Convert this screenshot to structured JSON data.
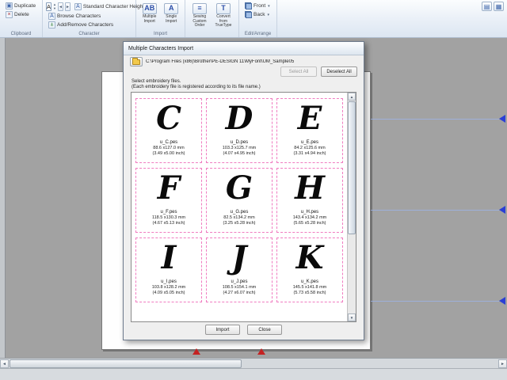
{
  "ribbon": {
    "clipboard": {
      "label": "Clipboard",
      "duplicate": "Duplicate",
      "delete": "Delete"
    },
    "character": {
      "label": "Character",
      "font_letter": "A",
      "standard_height": "Standard Character Height",
      "browse": "Browse Characters",
      "add_remove": "Add/Remove Characters"
    },
    "import": {
      "label": "Import",
      "multiple": "Multiple Import",
      "single": "Single Import"
    },
    "tools": {
      "sewing": "Sewing Custom Order",
      "convert": "Convert from TrueType"
    },
    "arrange": {
      "label": "Edit/Arrange",
      "front": "Front",
      "back": "Back"
    }
  },
  "dialog": {
    "title": "Multiple Characters Import",
    "path": "C:\\Program Files (x86)\\Brother\\PE-DESIGN 11\\MyFont\\UM_Sample05",
    "select_all": "Select All",
    "deselect_all": "Deselect All",
    "instruction_line1": "Select embroidery files.",
    "instruction_line2": "(Each embroidery file is registered according to its file name.)",
    "tiles": [
      {
        "letter": "C",
        "file": "u_C.pes",
        "size_mm": "88.6 x127.0 mm",
        "size_inch": "(3.49 x5.00 inch)"
      },
      {
        "letter": "D",
        "file": "u_D.pes",
        "size_mm": "103.3 x125.7 mm",
        "size_inch": "(4.07 x4.95 inch)"
      },
      {
        "letter": "E",
        "file": "u_E.pes",
        "size_mm": "84.2 x125.6 mm",
        "size_inch": "(3.31 x4.94 inch)"
      },
      {
        "letter": "F",
        "file": "u_F.pes",
        "size_mm": "118.5 x130.3 mm",
        "size_inch": "(4.67 x5.13 inch)"
      },
      {
        "letter": "G",
        "file": "u_G.pes",
        "size_mm": "82.5 x134.2 mm",
        "size_inch": "(3.25 x5.28 inch)"
      },
      {
        "letter": "H",
        "file": "u_H.pes",
        "size_mm": "143.4 x134.2 mm",
        "size_inch": "(5.65 x5.28 inch)"
      },
      {
        "letter": "I",
        "file": "u_I.pes",
        "size_mm": "103.8 x128.2 mm",
        "size_inch": "(4.09 x5.05 inch)"
      },
      {
        "letter": "J",
        "file": "u_J.pes",
        "size_mm": "108.5 x154.1 mm",
        "size_inch": "(4.27 x6.07 inch)"
      },
      {
        "letter": "K",
        "file": "u_K.pes",
        "size_mm": "145.5 x141.8 mm",
        "size_inch": "(5.73 x5.58 inch)"
      }
    ],
    "import_button": "Import",
    "close_button": "Close"
  },
  "icons": {
    "duplicate": "▣",
    "delete": "×",
    "letter_a": "A",
    "browse": "A",
    "add_remove": "±",
    "up": "▲",
    "down": "▼",
    "left": "◄",
    "right": "►",
    "dropdown": "▾",
    "multiple_import": "AB",
    "single_import": "A",
    "sewing": "≡",
    "convert": "T",
    "panel1": "▤",
    "panel2": "▦"
  },
  "colors": {
    "tile_border": "#f07cc0",
    "guide_blue": "#2b3fd6",
    "marker_red": "#c42222"
  }
}
